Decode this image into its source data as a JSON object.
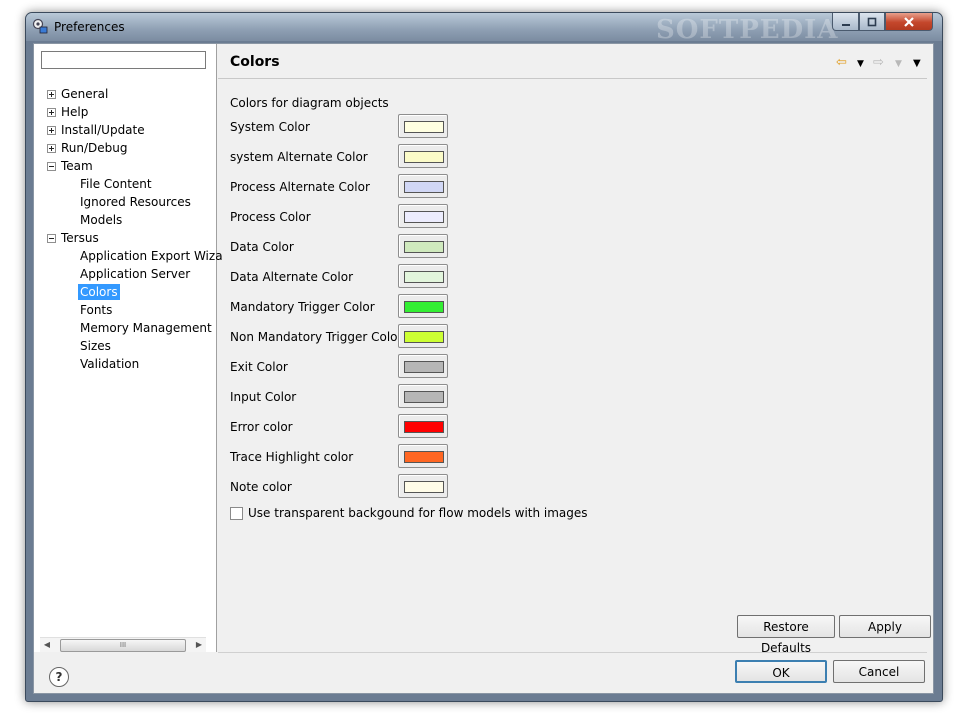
{
  "window": {
    "title": "Preferences",
    "watermark": "SOFTPEDIA"
  },
  "sidebar": {
    "filter_value": "",
    "tree": [
      {
        "label": "General",
        "level": 0,
        "toggle": "plus"
      },
      {
        "label": "Help",
        "level": 0,
        "toggle": "plus"
      },
      {
        "label": "Install/Update",
        "level": 0,
        "toggle": "plus"
      },
      {
        "label": "Run/Debug",
        "level": 0,
        "toggle": "plus"
      },
      {
        "label": "Team",
        "level": 0,
        "toggle": "minus"
      },
      {
        "label": "File Content",
        "level": 1
      },
      {
        "label": "Ignored Resources",
        "level": 1
      },
      {
        "label": "Models",
        "level": 1
      },
      {
        "label": "Tersus",
        "level": 0,
        "toggle": "minus"
      },
      {
        "label": "Application Export Wiza",
        "level": 1
      },
      {
        "label": "Application Server",
        "level": 1
      },
      {
        "label": "Colors",
        "level": 1,
        "selected": true
      },
      {
        "label": "Fonts",
        "level": 1
      },
      {
        "label": "Memory Management",
        "level": 1
      },
      {
        "label": "Sizes",
        "level": 1
      },
      {
        "label": "Validation",
        "level": 1
      }
    ],
    "scroll_label": "III"
  },
  "content": {
    "title": "Colors",
    "section_label": "Colors for diagram objects",
    "colors": [
      {
        "label": "System Color",
        "color": "#ffffe1"
      },
      {
        "label": "system Alternate Color",
        "color": "#fbfbc8"
      },
      {
        "label": "Process Alternate Color",
        "color": "#d1d7f5"
      },
      {
        "label": "Process Color",
        "color": "#ececfd"
      },
      {
        "label": "Data Color",
        "color": "#cfe9bd"
      },
      {
        "label": "Data Alternate Color",
        "color": "#e2f5dc"
      },
      {
        "label": "Mandatory Trigger Color",
        "color": "#33ee33"
      },
      {
        "label": "Non Mandatory Trigger Color",
        "color": "#ccff33"
      },
      {
        "label": "Exit Color",
        "color": "#b6b6b6"
      },
      {
        "label": "Input Color",
        "color": "#b6b6b6"
      },
      {
        "label": "Error color",
        "color": "#ff0000"
      },
      {
        "label": "Trace Highlight color",
        "color": "#ff6622"
      },
      {
        "label": "Note color",
        "color": "#fffce8"
      }
    ],
    "checkbox_label": "Use transparent backgound for flow models with images",
    "checkbox_checked": false,
    "restore_defaults": "Restore Defaults",
    "apply": "Apply"
  },
  "footer": {
    "help": "?",
    "ok": "OK",
    "cancel": "Cancel"
  },
  "icons": {
    "back": "back-arrow-icon",
    "forward": "forward-arrow-icon",
    "menu": "view-menu-icon"
  }
}
